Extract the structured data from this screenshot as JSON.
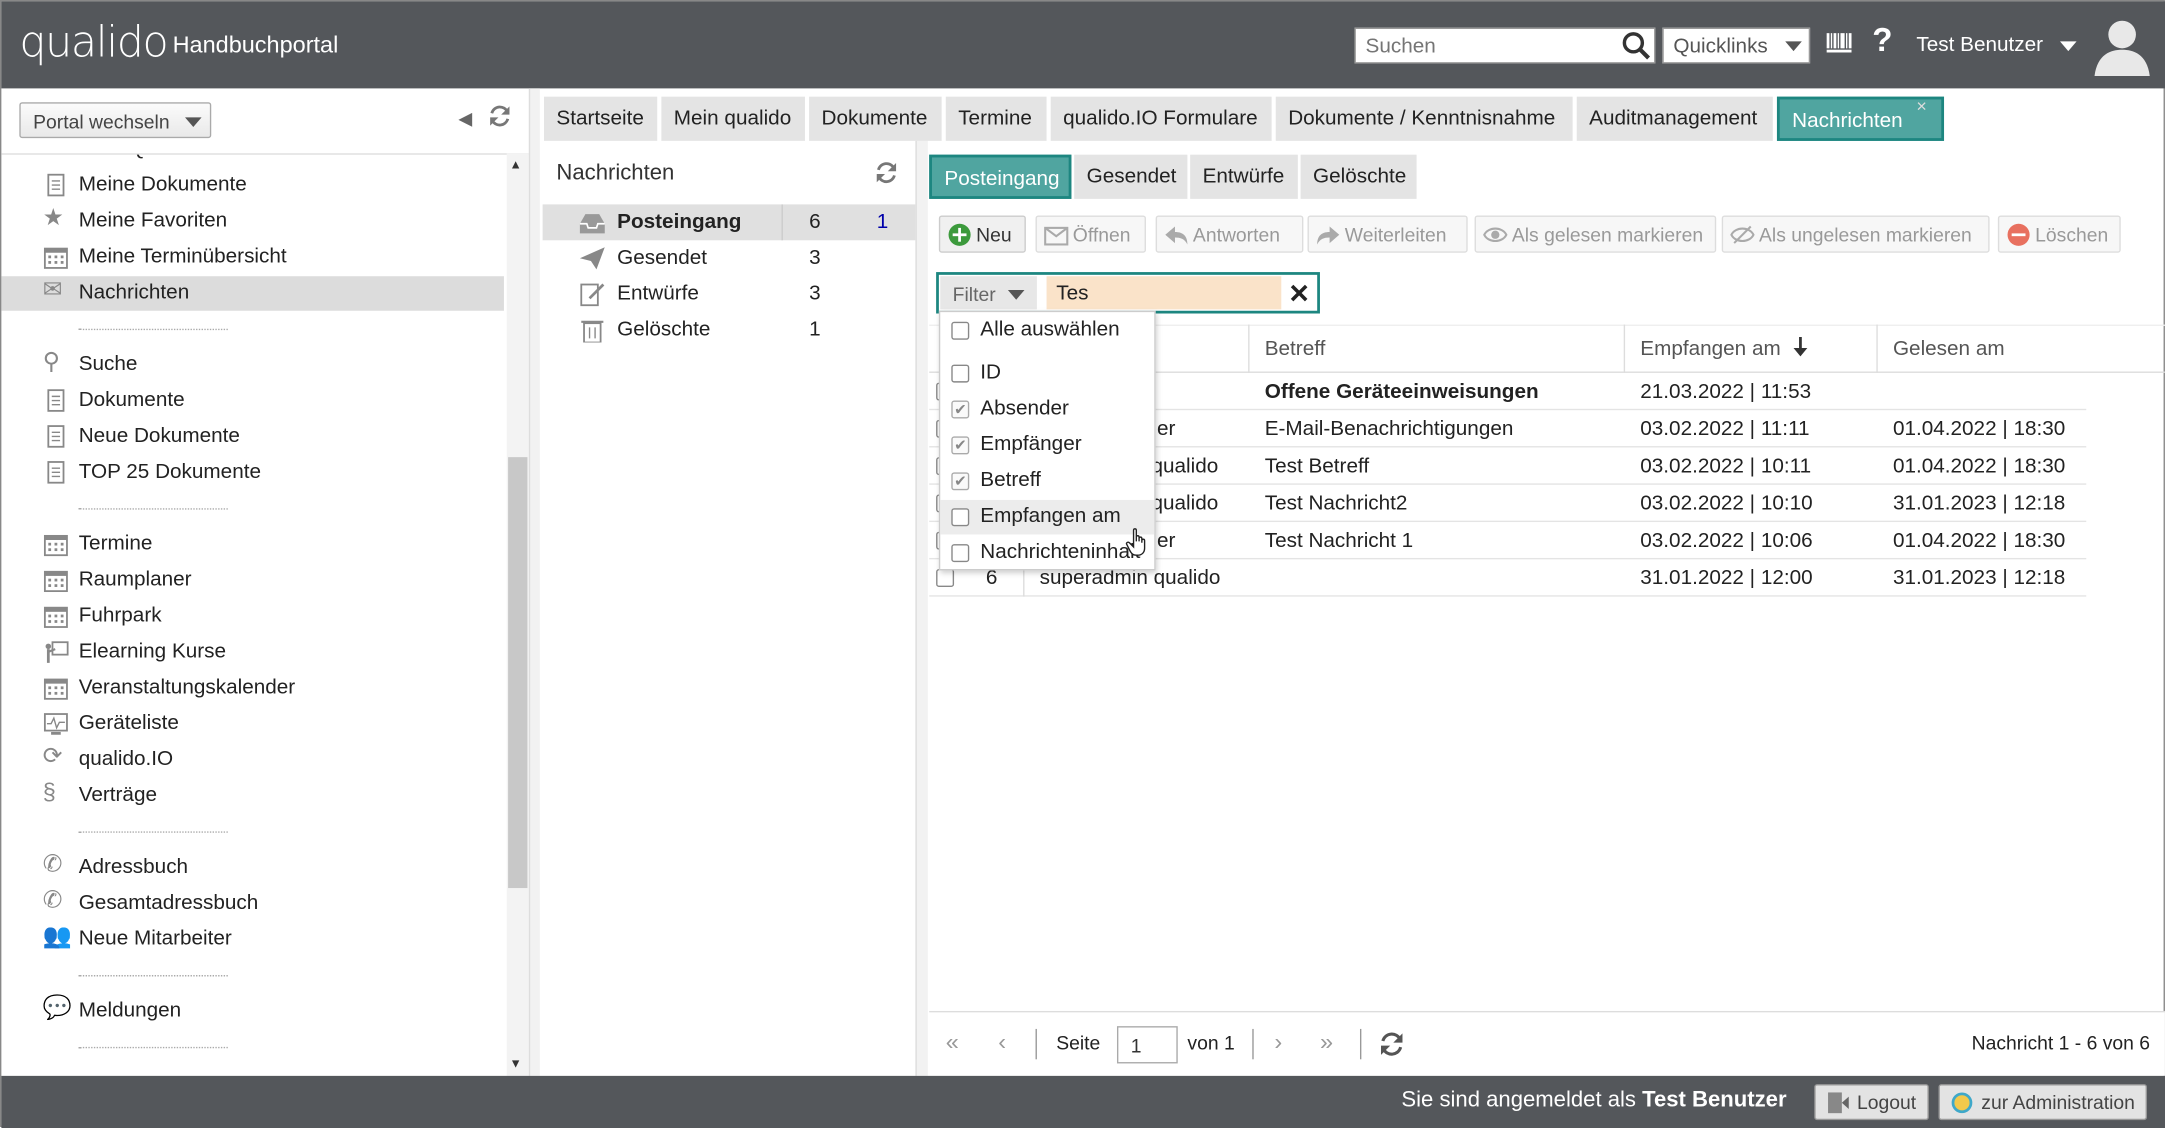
{
  "header": {
    "logo": "qualido",
    "portal_title": "Handbuchportal",
    "search_placeholder": "Suchen",
    "quicklinks": "Quicklinks",
    "help": "?",
    "user": "Test Benutzer"
  },
  "left": {
    "portal_switch": "Portal wechseln",
    "items": [
      {
        "label": "Mein Qualido",
        "icon": "gauge-icon"
      },
      {
        "label": "Meine Dokumente",
        "icon": "document-icon"
      },
      {
        "label": "Meine Favoriten",
        "icon": "star-icon"
      },
      {
        "label": "Meine Terminübersicht",
        "icon": "calendar-icon"
      },
      {
        "label": "Nachrichten",
        "icon": "envelope-icon"
      },
      {
        "label": "Suche",
        "icon": "search-icon"
      },
      {
        "label": "Dokumente",
        "icon": "document-icon"
      },
      {
        "label": "Neue Dokumente",
        "icon": "document-icon"
      },
      {
        "label": "TOP 25 Dokumente",
        "icon": "document-icon"
      },
      {
        "label": "Termine",
        "icon": "calendar-icon"
      },
      {
        "label": "Raumplaner",
        "icon": "calendar-icon"
      },
      {
        "label": "Fuhrpark",
        "icon": "calendar-icon"
      },
      {
        "label": "Elearning Kurse",
        "icon": "presentation-icon"
      },
      {
        "label": "Veranstaltungskalender",
        "icon": "calendar-icon"
      },
      {
        "label": "Geräteliste",
        "icon": "device-icon"
      },
      {
        "label": "qualido.IO",
        "icon": "cycle-icon"
      },
      {
        "label": "Verträge",
        "icon": "paragraph-icon"
      },
      {
        "label": "Adressbuch",
        "icon": "phone-icon"
      },
      {
        "label": "Gesamtadressbuch",
        "icon": "phone-icon"
      },
      {
        "label": "Neue Mitarbeiter",
        "icon": "people-icon"
      },
      {
        "label": "Meldungen",
        "icon": "chat-icon"
      }
    ]
  },
  "main_tabs": [
    "Startseite",
    "Mein qualido",
    "Dokumente",
    "Termine",
    "qualido.IO Formulare",
    "Dokumente / Kenntnisnahme",
    "Auditmanagement",
    "Nachrichten"
  ],
  "tab_close": "×",
  "folders": {
    "title": "Nachrichten",
    "items": [
      {
        "label": "Posteingang",
        "count": "6",
        "unread": "1"
      },
      {
        "label": "Gesendet",
        "count": "3",
        "unread": ""
      },
      {
        "label": "Entwürfe",
        "count": "3",
        "unread": ""
      },
      {
        "label": "Gelöschte",
        "count": "1",
        "unread": ""
      }
    ]
  },
  "msg_tabs": [
    "Posteingang",
    "Gesendet",
    "Entwürfe",
    "Gelöschte"
  ],
  "toolbar": [
    "Neu",
    "Öffnen",
    "Antworten",
    "Weiterleiten",
    "Als gelesen markieren",
    "Als ungelesen markieren",
    "Löschen"
  ],
  "filter": {
    "label": "Filter",
    "value": "Tes",
    "clear": "✕"
  },
  "grid": {
    "headers": [
      "Betreff",
      "Empfangen am",
      "Gelesen am"
    ],
    "rows": [
      {
        "id": "",
        "sender": "",
        "subject": "Offene Geräteeinweisungen",
        "received": "21.03.2022 | 11:53",
        "read": ""
      },
      {
        "id": "",
        "sender": "er",
        "subject": "E-Mail-Benachrichtigungen",
        "received": "03.02.2022 | 11:11",
        "read": "01.04.2022 | 18:30"
      },
      {
        "id": "",
        "sender": "qualido",
        "subject": "Test Betreff",
        "received": "03.02.2022 | 10:11",
        "read": "01.04.2022 | 18:30"
      },
      {
        "id": "",
        "sender": "qualido",
        "subject": "Test Nachricht2",
        "received": "03.02.2022 | 10:10",
        "read": "31.01.2023 | 12:18"
      },
      {
        "id": "",
        "sender": "er",
        "subject": "Test Nachricht 1",
        "received": "03.02.2022 | 10:06",
        "read": "01.04.2022 | 18:30"
      },
      {
        "id": "6",
        "sender": "superadmin qualido",
        "subject": "",
        "received": "31.01.2022 | 12:00",
        "read": "31.01.2023 | 12:18"
      }
    ]
  },
  "columns_menu": [
    {
      "label": "Alle auswählen",
      "checked": false
    },
    {
      "label": "ID",
      "checked": false
    },
    {
      "label": "Absender",
      "checked": true
    },
    {
      "label": "Empfänger",
      "checked": true
    },
    {
      "label": "Betreff",
      "checked": true
    },
    {
      "label": "Empfangen am",
      "checked": false
    },
    {
      "label": "Nachrichteninhalt",
      "checked": false
    }
  ],
  "pager": {
    "page_label": "Seite",
    "page": "1",
    "of": "von 1",
    "summary": "Nachricht 1 - 6 von 6"
  },
  "footer": {
    "logged_in_prefix": "Sie sind angemeldet als",
    "user": "Test Benutzer",
    "logout": "Logout",
    "admin": "zur Administration"
  },
  "colors": {
    "header": "#54575b",
    "accent": "#50a5a0",
    "accent_border": "#1d8680",
    "filter_bg": "#fae3c9"
  }
}
